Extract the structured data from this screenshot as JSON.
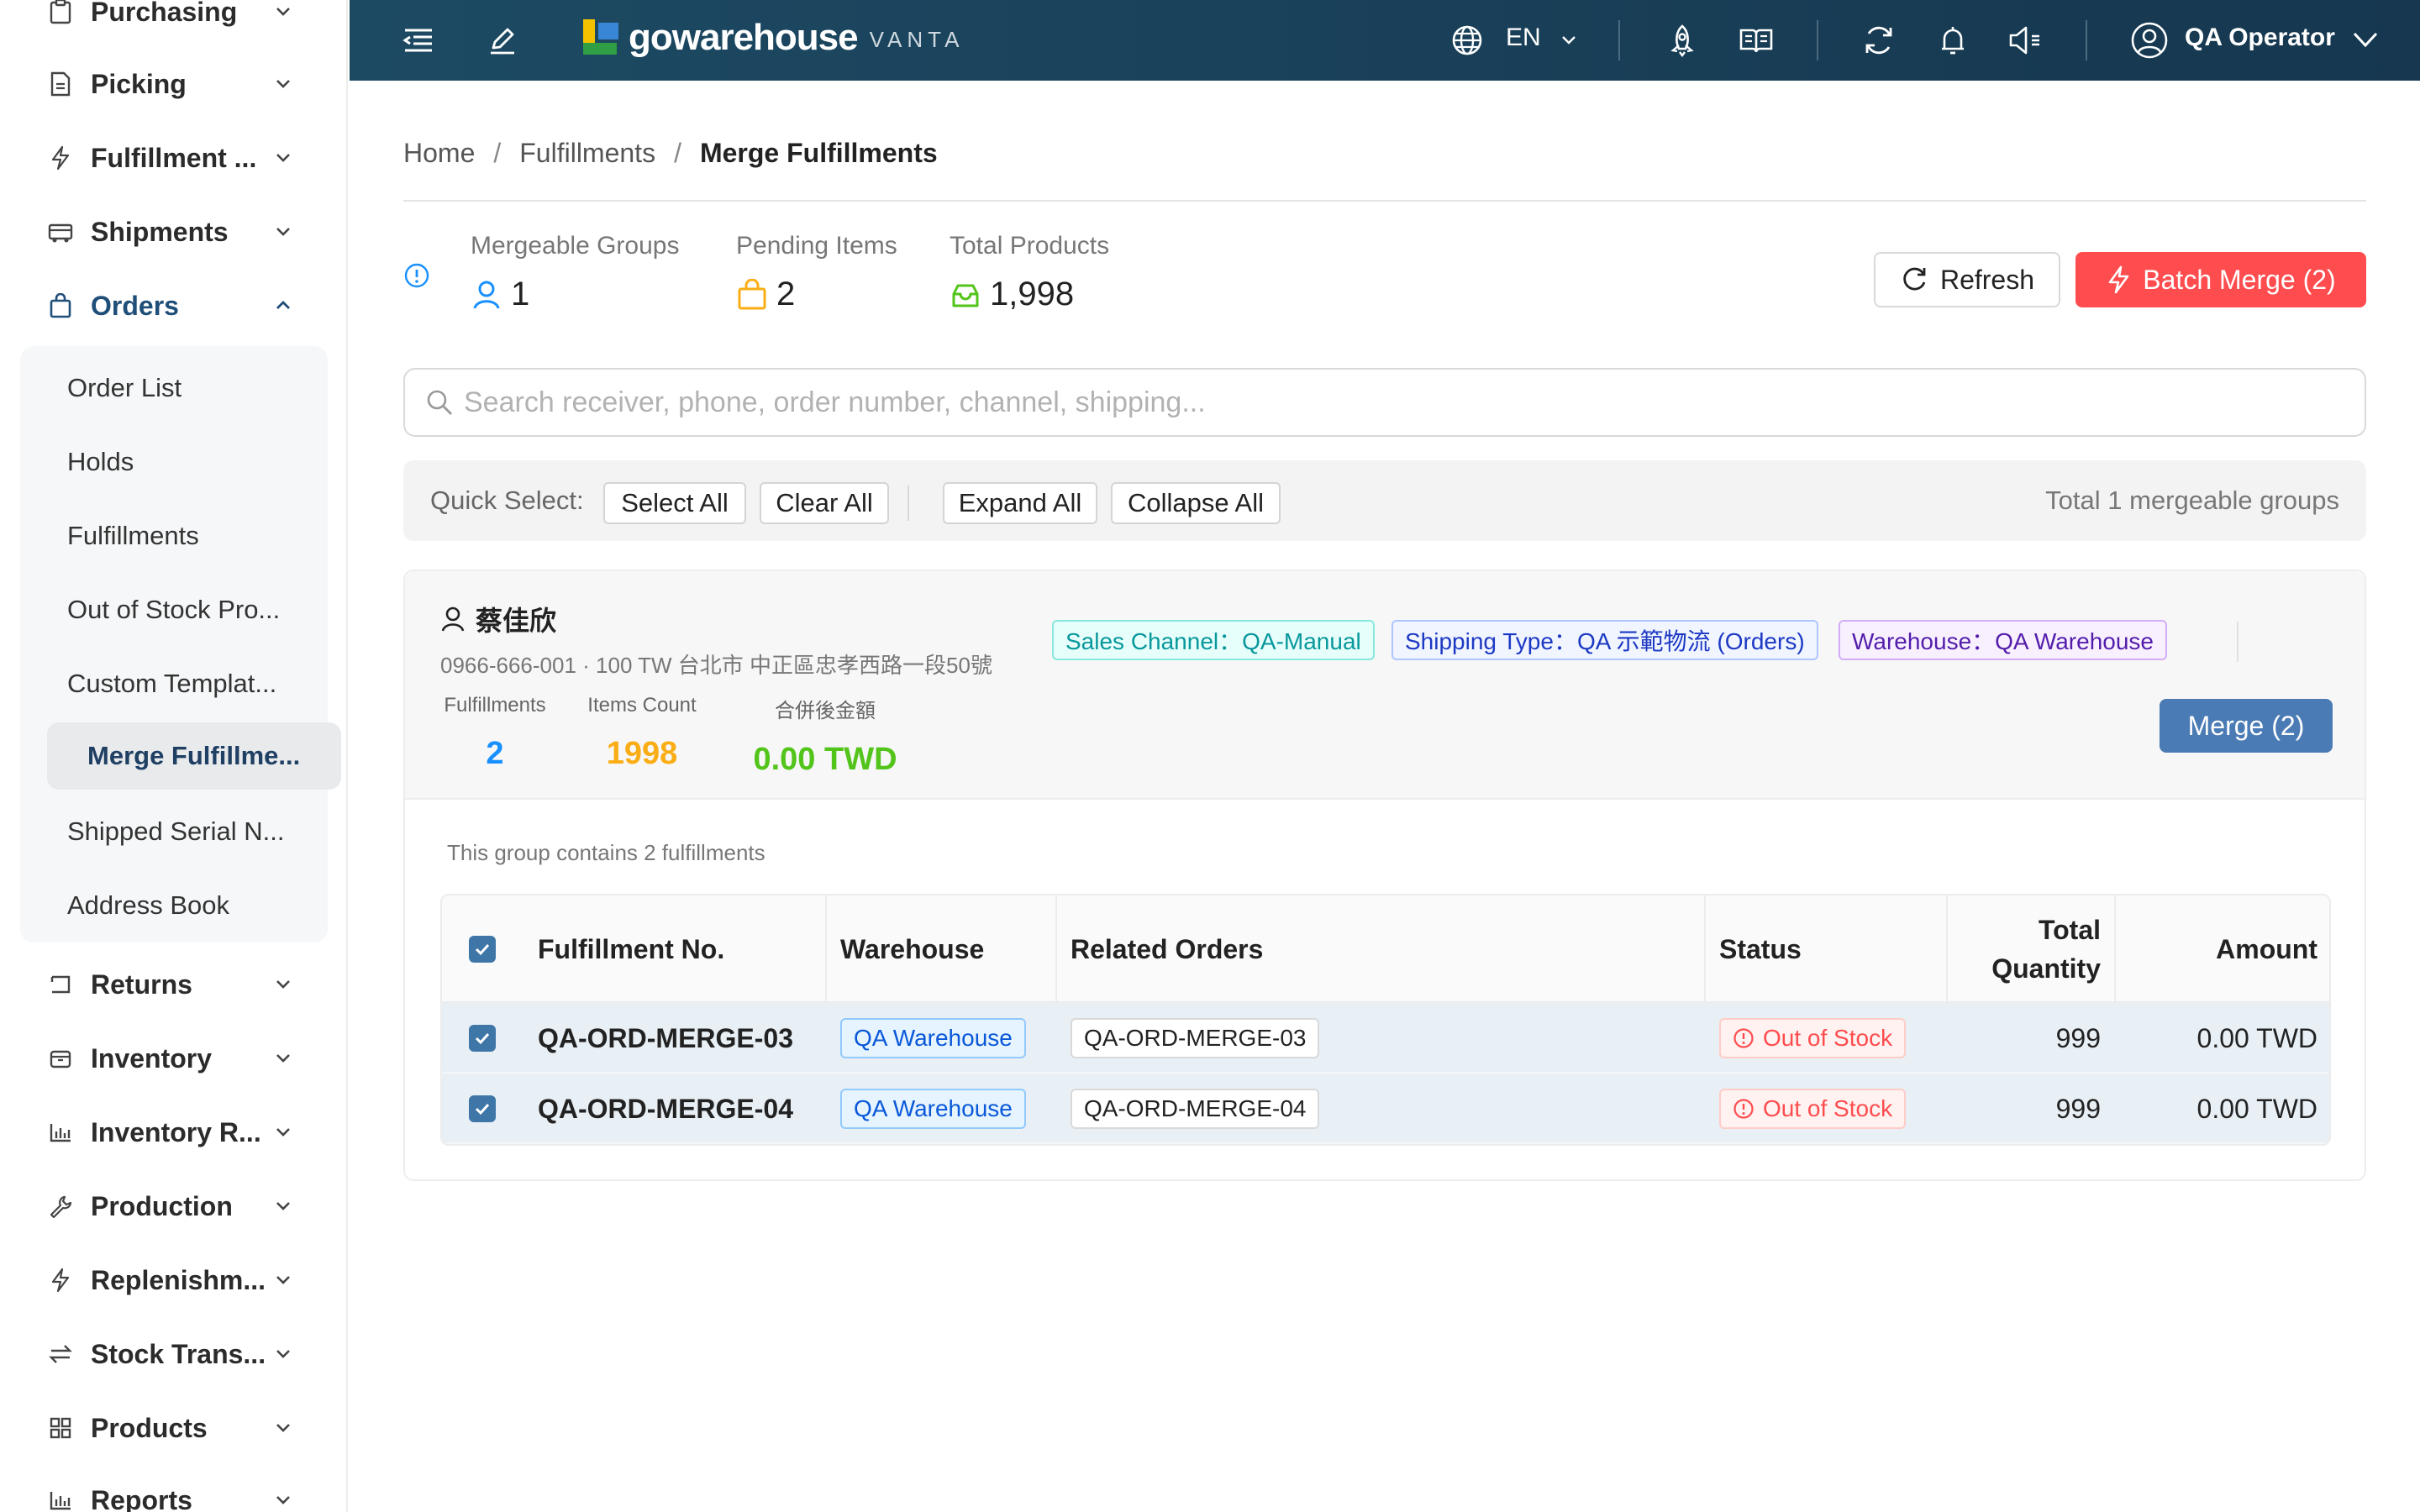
{
  "sidebar": {
    "items": [
      {
        "label": "Purchasing",
        "icon": "clipboard-icon"
      },
      {
        "label": "Picking",
        "icon": "document-icon"
      },
      {
        "label": "Fulfillment ...",
        "icon": "lightning-icon"
      },
      {
        "label": "Shipments",
        "icon": "truck-icon"
      },
      {
        "label": "Orders",
        "icon": "shopping-bag-icon"
      },
      {
        "label": "Returns",
        "icon": "return-icon"
      },
      {
        "label": "Inventory",
        "icon": "box-icon"
      },
      {
        "label": "Inventory R...",
        "icon": "bar-chart-icon"
      },
      {
        "label": "Production",
        "icon": "wrench-icon"
      },
      {
        "label": "Replenishm...",
        "icon": "lightning-icon"
      },
      {
        "label": "Stock Trans...",
        "icon": "transfer-icon"
      },
      {
        "label": "Products",
        "icon": "grid-icon"
      },
      {
        "label": "Reports",
        "icon": "bar-chart-icon"
      }
    ],
    "orders_submenu": [
      "Order List",
      "Holds",
      "Fulfillments",
      "Out of Stock Pro...",
      "Custom Templat...",
      "Merge Fulfillme...",
      "Shipped Serial N...",
      "Address Book"
    ]
  },
  "header": {
    "logo_text": "gowarehouse",
    "logo_sub": "VANTA",
    "language": "EN",
    "user_name": "QA Operator"
  },
  "breadcrumb": {
    "home": "Home",
    "parent": "Fulfillments",
    "current": "Merge Fulfillments"
  },
  "stats": {
    "mergeable_groups_label": "Mergeable Groups",
    "mergeable_groups_value": "1",
    "pending_items_label": "Pending Items",
    "pending_items_value": "2",
    "total_products_label": "Total Products",
    "total_products_value": "1,998"
  },
  "actions": {
    "refresh_label": "Refresh",
    "batch_merge_label": "Batch Merge (2)"
  },
  "search": {
    "placeholder": "Search receiver, phone, order number, channel, shipping..."
  },
  "quick_select": {
    "label": "Quick Select:",
    "select_all": "Select All",
    "clear_all": "Clear All",
    "expand_all": "Expand All",
    "collapse_all": "Collapse All",
    "total_text": "Total 1 mergeable groups"
  },
  "group": {
    "receiver": "蔡佳欣",
    "address": "0966-666-001 · 100 TW 台北市 中正區忠孝西路一段50號",
    "fulfillments_label": "Fulfillments",
    "fulfillments_value": "2",
    "items_count_label": "Items Count",
    "items_count_value": "1998",
    "merged_amount_label": "合併後金額",
    "merged_amount_value": "0.00 TWD",
    "tag_sales_channel": "Sales Channel：QA-Manual",
    "tag_shipping_type": "Shipping Type：QA 示範物流 (Orders)",
    "tag_warehouse": "Warehouse：QA Warehouse",
    "merge_button": "Merge (2)",
    "note": "This group contains 2 fulfillments"
  },
  "table": {
    "headers": {
      "fulfillment_no": "Fulfillment No.",
      "warehouse": "Warehouse",
      "related_orders": "Related Orders",
      "status": "Status",
      "total_quantity_1": "Total",
      "total_quantity_2": "Quantity",
      "amount": "Amount"
    },
    "rows": [
      {
        "no": "QA-ORD-MERGE-03",
        "warehouse": "QA Warehouse",
        "order": "QA-ORD-MERGE-03",
        "status": "Out of Stock",
        "qty": "999",
        "amount": "0.00 TWD"
      },
      {
        "no": "QA-ORD-MERGE-04",
        "warehouse": "QA Warehouse",
        "order": "QA-ORD-MERGE-04",
        "status": "Out of Stock",
        "qty": "999",
        "amount": "0.00 TWD"
      }
    ]
  },
  "colors": {
    "header_bg": "#1d4a63",
    "danger": "#ff4d4f",
    "primary": "#4a7bb5",
    "pending_orange": "#faad14",
    "success_green": "#52c41a",
    "link_blue": "#1890ff"
  }
}
